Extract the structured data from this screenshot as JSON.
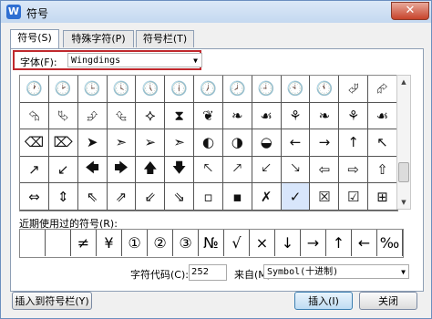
{
  "window": {
    "title": "符号",
    "app_icon": "W",
    "close_glyph": "✕"
  },
  "tabs": [
    {
      "label": "符号(S)",
      "active": true
    },
    {
      "label": "特殊字符(P)",
      "active": false
    },
    {
      "label": "符号栏(T)",
      "active": false
    }
  ],
  "font": {
    "label": "字体(F):",
    "value": "Wingdings"
  },
  "symbol_grid": {
    "columns": 13,
    "rows": [
      [
        "🕐",
        "🕑",
        "🕒",
        "🕓",
        "🕔",
        "🕕",
        "🕖",
        "🕗",
        "🕘",
        "🕙",
        "🕚",
        "⮰",
        "⮳"
      ],
      [
        "⮲",
        "⮱",
        "⮵",
        "⮴",
        "⯎",
        "⧗",
        "❦",
        "❧",
        "☙",
        "⚘",
        "❧",
        "⚘",
        "☙"
      ],
      [
        "⌫",
        "⌦",
        "➤",
        "➣",
        "➢",
        "➣",
        "◐",
        "◑",
        "◒",
        "←",
        "→",
        "↑",
        "↖"
      ],
      [
        "↗",
        "↙",
        "🡄",
        "🡆",
        "🡅",
        "🡇",
        "🡔",
        "🡕",
        "🡗",
        "🡖",
        "⇦",
        "⇨",
        "⇧"
      ],
      [
        "⇔",
        "⇕",
        "⇖",
        "⇗",
        "⇙",
        "⇘",
        "▫",
        "▪",
        "✗",
        "✓",
        "☒",
        "☑",
        "⊞"
      ]
    ],
    "selected": {
      "row": 4,
      "col": 9
    }
  },
  "recent": {
    "label": "近期使用过的符号(R):",
    "items": [
      "",
      "",
      "≠",
      "¥",
      "①",
      "②",
      "③",
      "№",
      "√",
      "×",
      "↓",
      "→",
      "↑",
      "←",
      "‰"
    ]
  },
  "char_code": {
    "label": "字符代码(C):",
    "value": "252"
  },
  "from": {
    "label": "来自(M)",
    "value": "Symbol(十进制)"
  },
  "buttons": {
    "insert_to_bar": "插入到符号栏(Y)",
    "insert": "插入(I)",
    "close": "关闭"
  },
  "icons": {
    "dropdown": "chevron-down-icon",
    "scroll_up": "arrow-up-icon",
    "scroll_down": "arrow-down-icon"
  }
}
